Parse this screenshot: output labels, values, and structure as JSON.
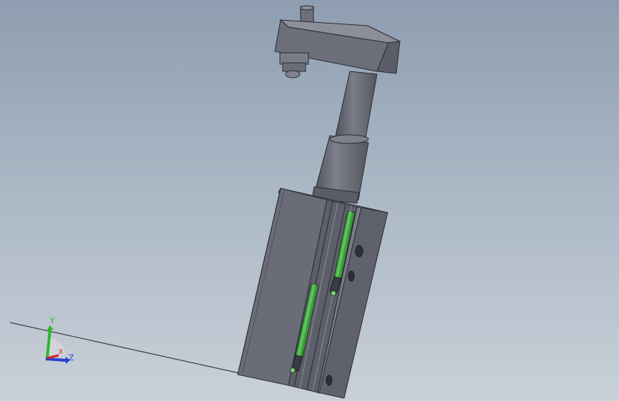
{
  "viewport": {
    "background_top": "#8e9eb0",
    "background_bottom": "#c9d0d8"
  },
  "triad": {
    "y_label": "Y",
    "z_label": "Z",
    "x_label": "X",
    "y_color": "#2fb52f",
    "z_color": "#2a3fd0",
    "x_color": "#d02020"
  },
  "model": {
    "body_color": "#6a6c78",
    "sensor_color": "#3c9a3c"
  }
}
